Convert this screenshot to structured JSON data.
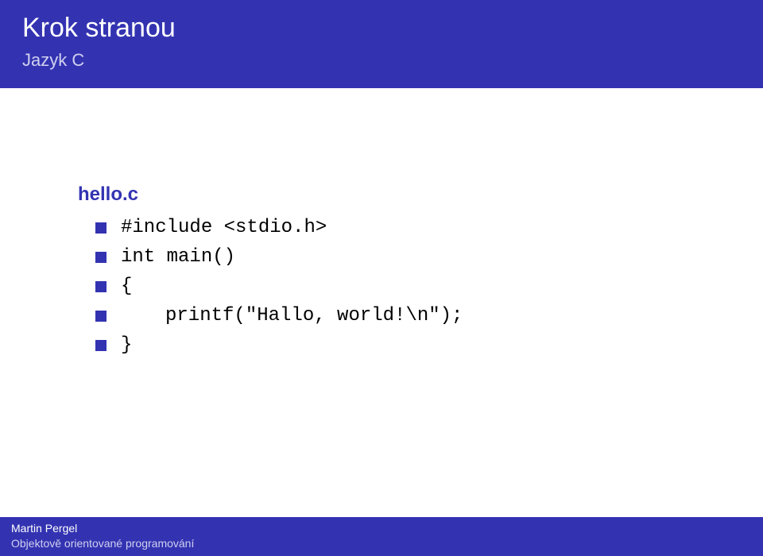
{
  "header": {
    "title": "Krok stranou",
    "subtitle": "Jazyk C"
  },
  "content": {
    "filename": "hello.c",
    "lines": [
      {
        "text": "#include <stdio.h>",
        "indent": false
      },
      {
        "text": "int main()",
        "indent": false
      },
      {
        "text": "{",
        "indent": false
      },
      {
        "text": "printf(\"Hallo, world!\\n\");",
        "indent": true
      },
      {
        "text": "}",
        "indent": false
      }
    ]
  },
  "footer": {
    "author": "Martin Pergel",
    "lecture": "Objektově orientované programování"
  }
}
